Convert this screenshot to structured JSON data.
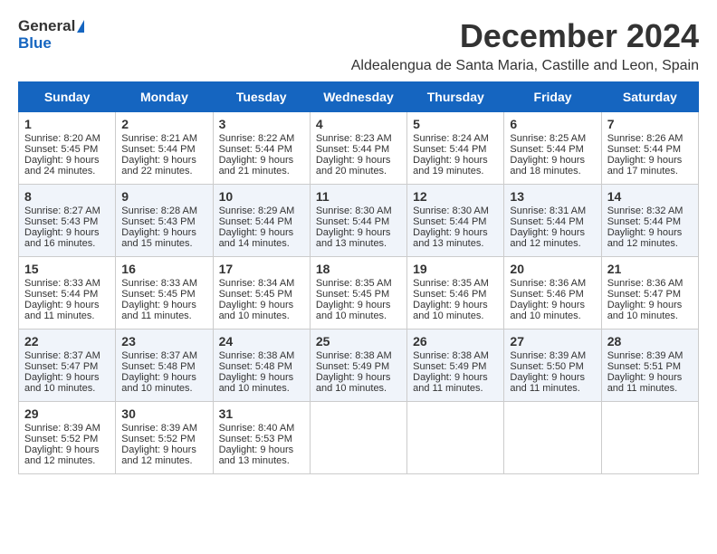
{
  "header": {
    "logo_general": "General",
    "logo_blue": "Blue",
    "month_title": "December 2024",
    "location": "Aldealengua de Santa Maria, Castille and Leon, Spain"
  },
  "days_of_week": [
    "Sunday",
    "Monday",
    "Tuesday",
    "Wednesday",
    "Thursday",
    "Friday",
    "Saturday"
  ],
  "weeks": [
    [
      {
        "day": 1,
        "sunrise": "Sunrise: 8:20 AM",
        "sunset": "Sunset: 5:45 PM",
        "daylight": "Daylight: 9 hours and 24 minutes."
      },
      {
        "day": 2,
        "sunrise": "Sunrise: 8:21 AM",
        "sunset": "Sunset: 5:44 PM",
        "daylight": "Daylight: 9 hours and 22 minutes."
      },
      {
        "day": 3,
        "sunrise": "Sunrise: 8:22 AM",
        "sunset": "Sunset: 5:44 PM",
        "daylight": "Daylight: 9 hours and 21 minutes."
      },
      {
        "day": 4,
        "sunrise": "Sunrise: 8:23 AM",
        "sunset": "Sunset: 5:44 PM",
        "daylight": "Daylight: 9 hours and 20 minutes."
      },
      {
        "day": 5,
        "sunrise": "Sunrise: 8:24 AM",
        "sunset": "Sunset: 5:44 PM",
        "daylight": "Daylight: 9 hours and 19 minutes."
      },
      {
        "day": 6,
        "sunrise": "Sunrise: 8:25 AM",
        "sunset": "Sunset: 5:44 PM",
        "daylight": "Daylight: 9 hours and 18 minutes."
      },
      {
        "day": 7,
        "sunrise": "Sunrise: 8:26 AM",
        "sunset": "Sunset: 5:44 PM",
        "daylight": "Daylight: 9 hours and 17 minutes."
      }
    ],
    [
      {
        "day": 8,
        "sunrise": "Sunrise: 8:27 AM",
        "sunset": "Sunset: 5:43 PM",
        "daylight": "Daylight: 9 hours and 16 minutes."
      },
      {
        "day": 9,
        "sunrise": "Sunrise: 8:28 AM",
        "sunset": "Sunset: 5:43 PM",
        "daylight": "Daylight: 9 hours and 15 minutes."
      },
      {
        "day": 10,
        "sunrise": "Sunrise: 8:29 AM",
        "sunset": "Sunset: 5:44 PM",
        "daylight": "Daylight: 9 hours and 14 minutes."
      },
      {
        "day": 11,
        "sunrise": "Sunrise: 8:30 AM",
        "sunset": "Sunset: 5:44 PM",
        "daylight": "Daylight: 9 hours and 13 minutes."
      },
      {
        "day": 12,
        "sunrise": "Sunrise: 8:30 AM",
        "sunset": "Sunset: 5:44 PM",
        "daylight": "Daylight: 9 hours and 13 minutes."
      },
      {
        "day": 13,
        "sunrise": "Sunrise: 8:31 AM",
        "sunset": "Sunset: 5:44 PM",
        "daylight": "Daylight: 9 hours and 12 minutes."
      },
      {
        "day": 14,
        "sunrise": "Sunrise: 8:32 AM",
        "sunset": "Sunset: 5:44 PM",
        "daylight": "Daylight: 9 hours and 12 minutes."
      }
    ],
    [
      {
        "day": 15,
        "sunrise": "Sunrise: 8:33 AM",
        "sunset": "Sunset: 5:44 PM",
        "daylight": "Daylight: 9 hours and 11 minutes."
      },
      {
        "day": 16,
        "sunrise": "Sunrise: 8:33 AM",
        "sunset": "Sunset: 5:45 PM",
        "daylight": "Daylight: 9 hours and 11 minutes."
      },
      {
        "day": 17,
        "sunrise": "Sunrise: 8:34 AM",
        "sunset": "Sunset: 5:45 PM",
        "daylight": "Daylight: 9 hours and 10 minutes."
      },
      {
        "day": 18,
        "sunrise": "Sunrise: 8:35 AM",
        "sunset": "Sunset: 5:45 PM",
        "daylight": "Daylight: 9 hours and 10 minutes."
      },
      {
        "day": 19,
        "sunrise": "Sunrise: 8:35 AM",
        "sunset": "Sunset: 5:46 PM",
        "daylight": "Daylight: 9 hours and 10 minutes."
      },
      {
        "day": 20,
        "sunrise": "Sunrise: 8:36 AM",
        "sunset": "Sunset: 5:46 PM",
        "daylight": "Daylight: 9 hours and 10 minutes."
      },
      {
        "day": 21,
        "sunrise": "Sunrise: 8:36 AM",
        "sunset": "Sunset: 5:47 PM",
        "daylight": "Daylight: 9 hours and 10 minutes."
      }
    ],
    [
      {
        "day": 22,
        "sunrise": "Sunrise: 8:37 AM",
        "sunset": "Sunset: 5:47 PM",
        "daylight": "Daylight: 9 hours and 10 minutes."
      },
      {
        "day": 23,
        "sunrise": "Sunrise: 8:37 AM",
        "sunset": "Sunset: 5:48 PM",
        "daylight": "Daylight: 9 hours and 10 minutes."
      },
      {
        "day": 24,
        "sunrise": "Sunrise: 8:38 AM",
        "sunset": "Sunset: 5:48 PM",
        "daylight": "Daylight: 9 hours and 10 minutes."
      },
      {
        "day": 25,
        "sunrise": "Sunrise: 8:38 AM",
        "sunset": "Sunset: 5:49 PM",
        "daylight": "Daylight: 9 hours and 10 minutes."
      },
      {
        "day": 26,
        "sunrise": "Sunrise: 8:38 AM",
        "sunset": "Sunset: 5:49 PM",
        "daylight": "Daylight: 9 hours and 11 minutes."
      },
      {
        "day": 27,
        "sunrise": "Sunrise: 8:39 AM",
        "sunset": "Sunset: 5:50 PM",
        "daylight": "Daylight: 9 hours and 11 minutes."
      },
      {
        "day": 28,
        "sunrise": "Sunrise: 8:39 AM",
        "sunset": "Sunset: 5:51 PM",
        "daylight": "Daylight: 9 hours and 11 minutes."
      }
    ],
    [
      {
        "day": 29,
        "sunrise": "Sunrise: 8:39 AM",
        "sunset": "Sunset: 5:52 PM",
        "daylight": "Daylight: 9 hours and 12 minutes."
      },
      {
        "day": 30,
        "sunrise": "Sunrise: 8:39 AM",
        "sunset": "Sunset: 5:52 PM",
        "daylight": "Daylight: 9 hours and 12 minutes."
      },
      {
        "day": 31,
        "sunrise": "Sunrise: 8:40 AM",
        "sunset": "Sunset: 5:53 PM",
        "daylight": "Daylight: 9 hours and 13 minutes."
      },
      null,
      null,
      null,
      null
    ]
  ]
}
